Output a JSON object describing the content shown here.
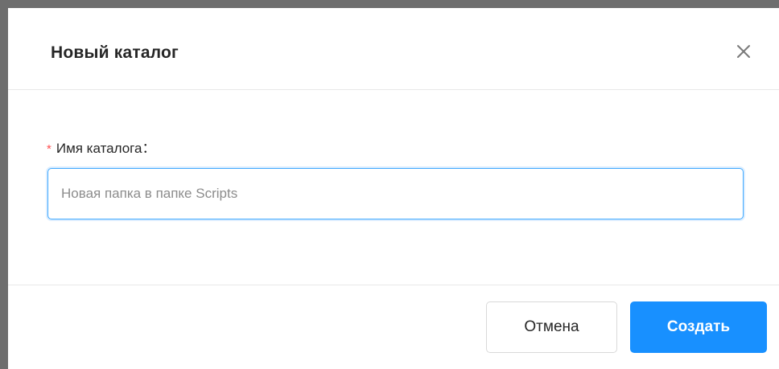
{
  "dialog": {
    "title": "Новый каталог",
    "close_icon": "close-icon"
  },
  "form": {
    "required_marker": "*",
    "label": "Имя каталога：",
    "input_value": "",
    "input_placeholder": "Новая папка в папке Scripts"
  },
  "footer": {
    "cancel_label": "Отмена",
    "create_label": "Создать"
  },
  "colors": {
    "primary": "#1890ff",
    "required": "#ff4d4f",
    "backdrop": "#6e6e6e"
  }
}
